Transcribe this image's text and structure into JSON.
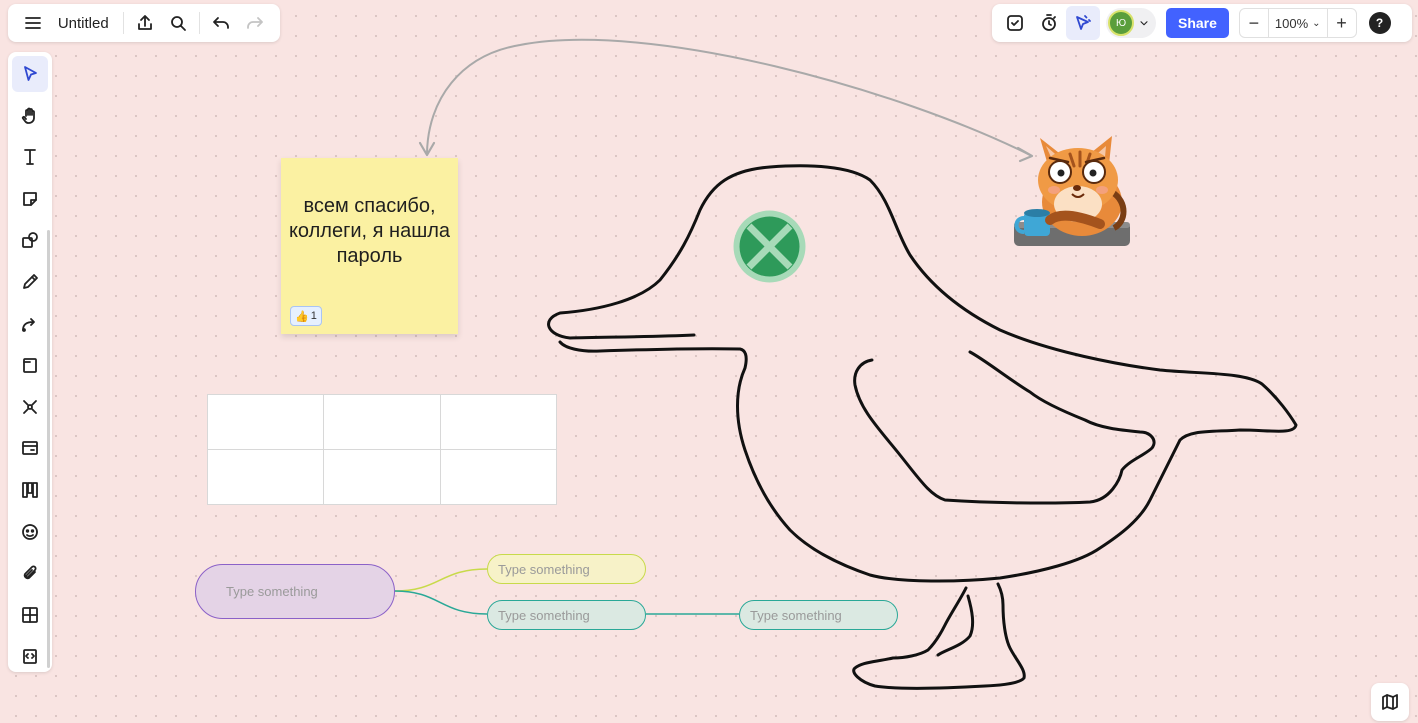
{
  "header": {
    "title": "Untitled",
    "menu_icon": "hamburger-menu-icon",
    "export_icon": "upload-icon",
    "search_icon": "search-icon",
    "undo_icon": "undo-icon",
    "redo_icon": "redo-icon"
  },
  "topright": {
    "avatar_initials": "Ю",
    "share_label": "Share",
    "zoom_level": "100%",
    "zoom_out": "−",
    "zoom_in": "+",
    "help": "?"
  },
  "toolbar": {
    "tools": [
      "select",
      "hand",
      "text",
      "sticky-note",
      "shapes",
      "pen",
      "connector",
      "frame",
      "mind-map",
      "card",
      "kanban",
      "stickers",
      "upload",
      "table",
      "more-apps"
    ],
    "active_tool": "select"
  },
  "sticky": {
    "text": "всем спасибо, коллеги, я нашла пароль",
    "reaction_emoji": "👍",
    "reaction_count": "1",
    "color": "#fbf1a2"
  },
  "table": {
    "rows": 2,
    "cols": 3
  },
  "mindmap": {
    "root": "Type something",
    "branch_a": "Type something",
    "branch_b": "Type something",
    "branch_c": "Type something"
  },
  "colors": {
    "background": "#f9e4e2",
    "accent": "#4262ff",
    "mindmap_root_border": "#8b61c8",
    "mindmap_branch_a": "#c8da4a",
    "mindmap_branch_teal": "#2aa897",
    "x_icon": "#2e9a5a"
  }
}
